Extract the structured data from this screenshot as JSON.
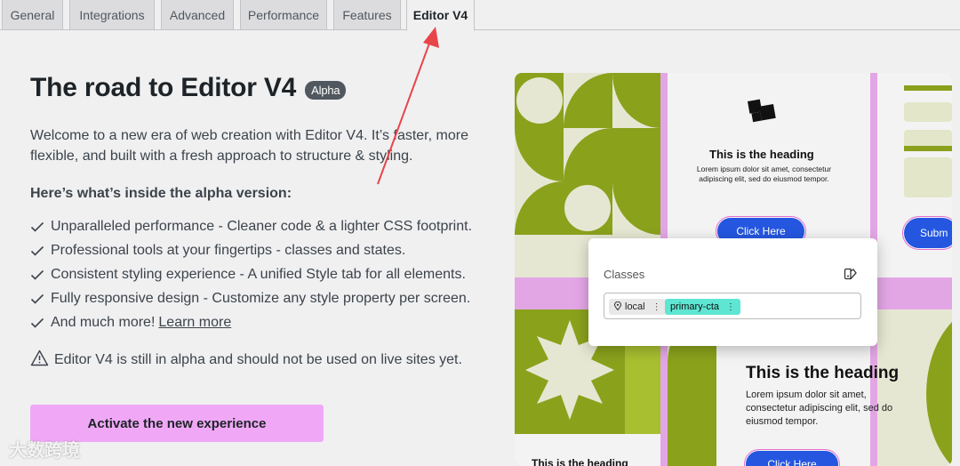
{
  "tabs": [
    {
      "label": "General"
    },
    {
      "label": "Integrations"
    },
    {
      "label": "Advanced"
    },
    {
      "label": "Performance"
    },
    {
      "label": "Features"
    },
    {
      "label": "Editor V4"
    }
  ],
  "main": {
    "title": "The road to Editor V4",
    "badge": "Alpha",
    "intro": "Welcome to a new era of web creation with Editor V4. It’s faster, more flexible, and built with a fresh approach to structure & styling.",
    "subheading": "Here’s what’s inside the alpha version:",
    "features": [
      "Unparalleled performance - Cleaner code & a lighter CSS footprint.",
      "Professional tools at your fingertips - classes and states.",
      "Consistent styling experience - A unified Style tab for all elements.",
      "Fully responsive design - Customize any style property per screen.",
      "And much more!"
    ],
    "learn_more": "Learn more",
    "warning": "Editor V4 is still in alpha and should not be used on live sites yet.",
    "cta": "Activate the new experience"
  },
  "preview": {
    "top_heading": "This is the heading",
    "top_text": "Lorem ipsum dolor sit amet, consectetur adipiscing elit, sed do eiusmod tempor.",
    "top_button": "Click Here",
    "right_button": "Subm",
    "bottom_heading": "This is the heading",
    "bottom_text": "Lorem ipsum dolor sit amet, consectetur adipiscing elit, sed do eiusmod tempor.",
    "bottom_button": "Click Here",
    "bottom_left_heading": "This is the heading",
    "classes_label": "Classes",
    "chip_local": "local",
    "chip_primary": "primary-cta"
  },
  "colors": {
    "accent_pink": "#f0a8f6",
    "annotation_arrow": "#e8454a",
    "olive": "#8aa11c",
    "teal_chip": "#5ee6d3"
  },
  "watermark": "大数跨境"
}
